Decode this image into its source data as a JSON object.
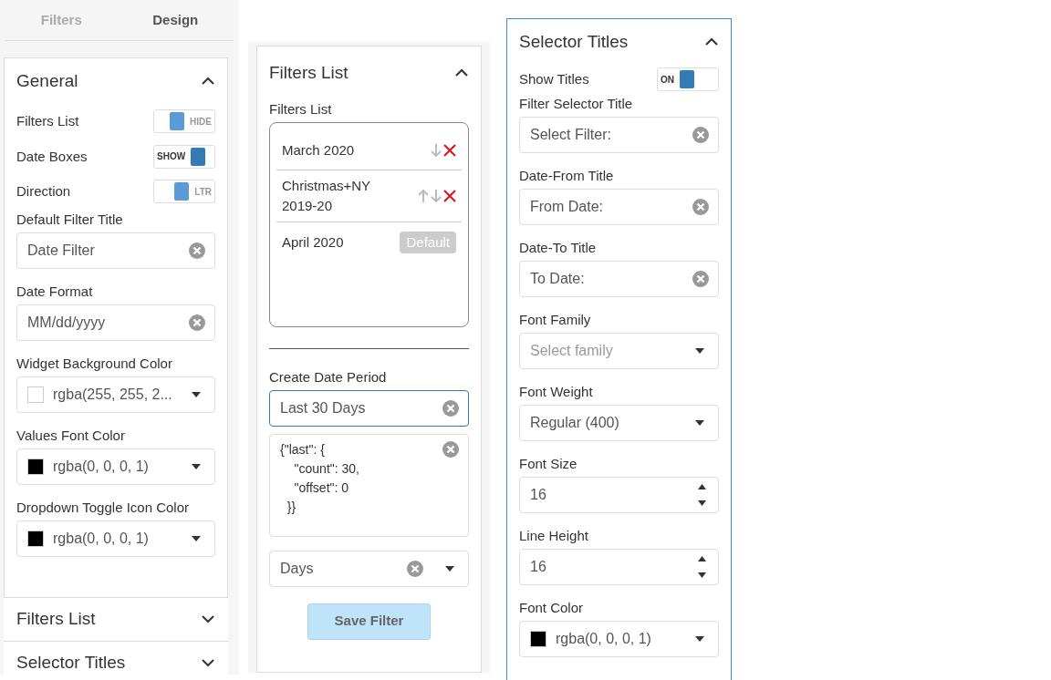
{
  "tabs": [
    {
      "label": "Filters",
      "selected": false
    },
    {
      "label": "Design",
      "selected": true
    }
  ],
  "general": {
    "title": "General",
    "expanded": true,
    "fields": [
      {
        "kind": "toggle",
        "label": "Filters List",
        "text": "HIDE",
        "on": false
      },
      {
        "kind": "toggle",
        "label": "Date Boxes",
        "text": "SHOW",
        "on": true
      },
      {
        "kind": "toggle",
        "label": "Direction",
        "text": "LTR",
        "on": false
      },
      {
        "kind": "text",
        "label": "Default Filter Title",
        "value": "Date Filter"
      },
      {
        "kind": "text",
        "label": "Date Format",
        "value": "MM/dd/yyyy"
      },
      {
        "kind": "color",
        "label": "Widget Background Color",
        "color": "#ffffff",
        "value": "rgba(255, 255, 2..."
      },
      {
        "kind": "color",
        "label": "Values Font Color",
        "color": "#000000",
        "value": "rgba(0, 0, 0, 1)"
      },
      {
        "kind": "color",
        "label": "Dropdown Toggle Icon Color",
        "color": "#000000",
        "value": "rgba(0, 0, 0, 1)"
      }
    ]
  },
  "sections": [
    {
      "title": "Filters List",
      "expanded": false
    },
    {
      "title": "Selector Titles",
      "expanded": false
    }
  ],
  "filters_panel": {
    "title": "Filters List",
    "expanded": true,
    "list_label": "Filters List",
    "items": [
      {
        "name": "March 2020",
        "up": false,
        "down": true,
        "removable": true
      },
      {
        "name": "Christmas+NY 2019-20",
        "up": true,
        "down": true,
        "removable": true
      },
      {
        "name": "April 2020",
        "up": false,
        "down": false,
        "removable": false,
        "badge": "Default"
      }
    ],
    "create_label": "Create Date Period",
    "name_value": "Last 30 Days",
    "name_focused": true,
    "definition": "{\"last\": {\n    \"count\": 30,\n    \"offset\": 0\n  }}",
    "unit": "Days",
    "save": {
      "label": "Save Filter",
      "disabled": true
    }
  },
  "titles_panel": {
    "title": "Selector Titles",
    "expanded": true,
    "fields": [
      {
        "kind": "toggle",
        "label": "Show Titles",
        "text": "ON",
        "on": true
      },
      {
        "kind": "text",
        "label": "Filter Selector Title",
        "value": "Select Filter:"
      },
      {
        "kind": "text",
        "label": "Date-From Title",
        "value": "From Date:"
      },
      {
        "kind": "text",
        "label": "Date-To Title",
        "value": "To Date:"
      },
      {
        "kind": "select",
        "label": "Font Family",
        "placeholder": "Select family"
      },
      {
        "kind": "select",
        "label": "Font Weight",
        "value": "Regular (400)"
      },
      {
        "kind": "number",
        "label": "Font Size",
        "value": "16"
      },
      {
        "kind": "number",
        "label": "Line Height",
        "value": "16"
      },
      {
        "kind": "color",
        "label": "Font Color",
        "color": "#000000",
        "value": "rgba(0, 0, 0, 1)"
      }
    ]
  }
}
